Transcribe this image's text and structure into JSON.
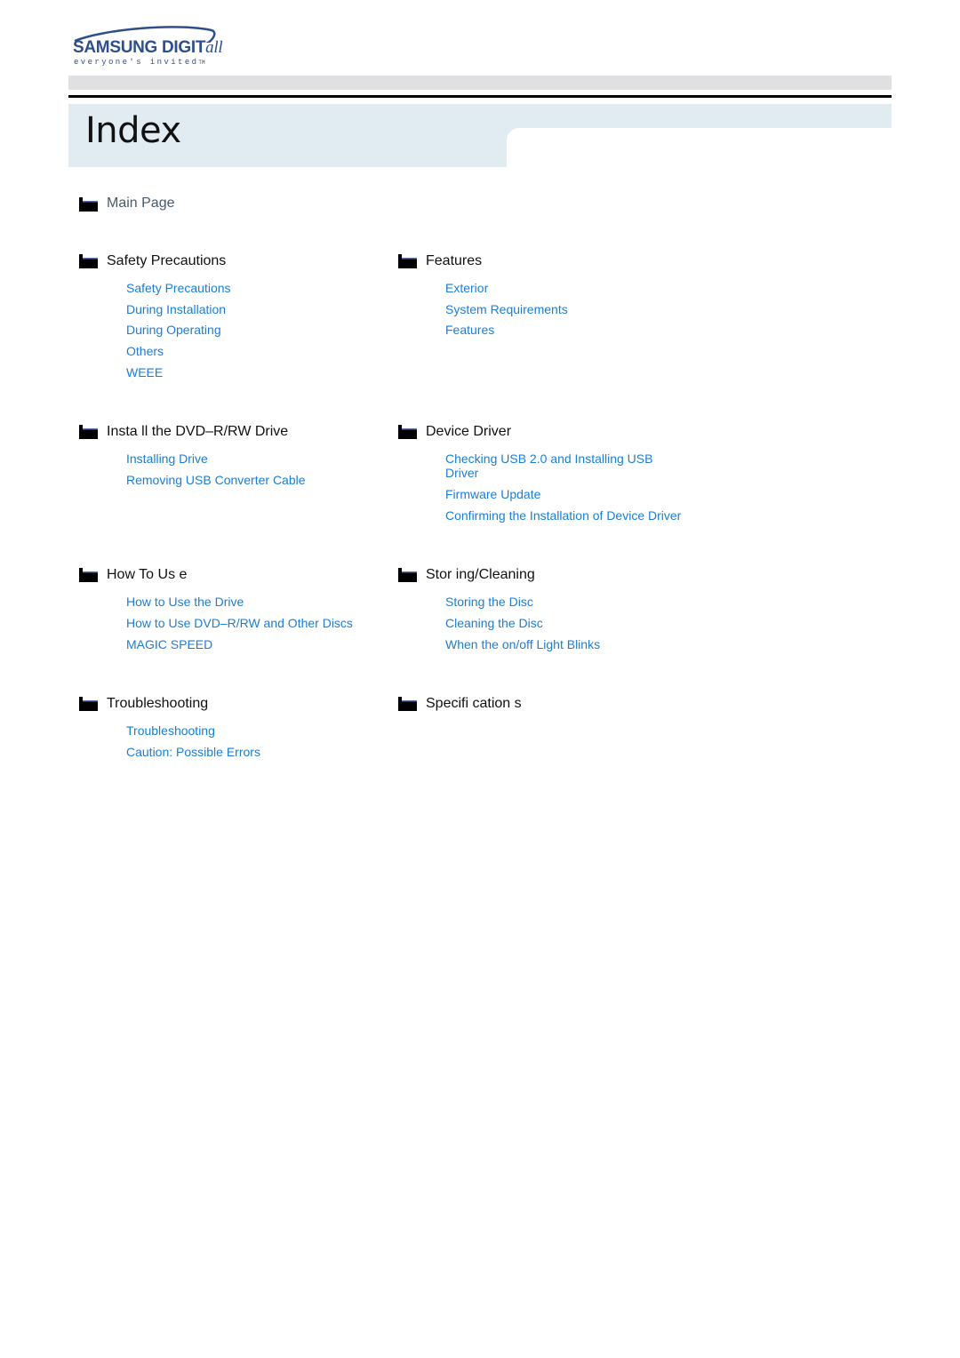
{
  "brand": {
    "name_main": "SAMSUNG DIGIT",
    "name_suffix": "all",
    "tagline": "everyone's invited",
    "tagline_tm": "TM",
    "logo_color": "#2f4f8a"
  },
  "page": {
    "title": "Index"
  },
  "main_link": "Main Page",
  "colors": {
    "link": "#1a7ed6",
    "heading": "#111111",
    "band": "#e1ecf2"
  },
  "sections": [
    {
      "heading": "Safety Precautions",
      "links": [
        "Safety Precautions",
        "During Installation",
        "During Operating",
        "Others",
        "WEEE"
      ]
    },
    {
      "heading": "Features",
      "links": [
        "Exterior",
        "System Requirements",
        "Features"
      ]
    },
    {
      "heading": "Insta ll the  DVD–R/RW Drive",
      "links": [
        "Installing Drive",
        "Removing USB Converter Cable"
      ]
    },
    {
      "heading": "Device Driver",
      "links": [
        "Checking USB 2.0 and Installing USB Driver",
        "Firmware Update",
        "Confirming the Installation of Device Driver"
      ]
    },
    {
      "heading": "How To Us e",
      "links": [
        "How to Use the Drive",
        "How to Use DVD–R/RW and Other Discs",
        "MAGIC SPEED"
      ]
    },
    {
      "heading": "Stor ing/Cleaning",
      "links": [
        "Storing the Disc",
        "Cleaning the Disc",
        "When the on/off Light Blinks"
      ]
    },
    {
      "heading": "Troubleshooting",
      "links": [
        "Troubleshooting",
        "Caution: Possible Errors"
      ]
    },
    {
      "heading": "Specifi cation s",
      "links": []
    }
  ]
}
